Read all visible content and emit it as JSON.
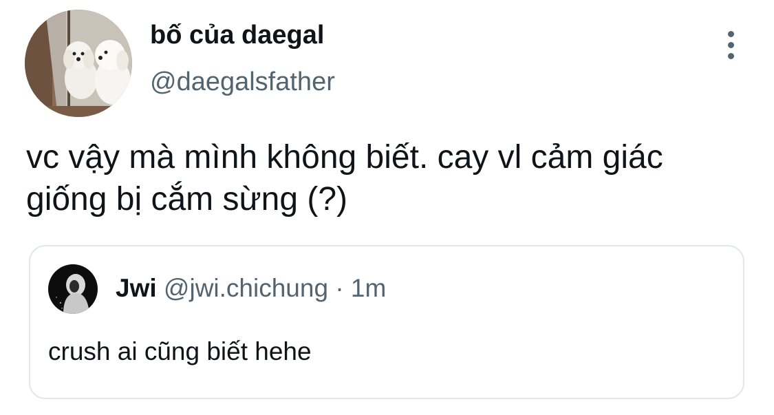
{
  "tweet": {
    "display_name": "bố của daegal",
    "handle": "@daegalsfather",
    "text": "vc vậy mà mình không biết. cay vl cảm giác giống bị cắm sừng (?)",
    "avatar_icon": "avatar-two-white-dogs",
    "more_icon": "more-vertical-icon"
  },
  "quoted_tweet": {
    "display_name": "Jwi",
    "handle": "@jwi.chichung",
    "separator": "·",
    "time": "1m",
    "text": "crush ai cũng biết hehe",
    "avatar_icon": "avatar-person-hoodie"
  },
  "colors": {
    "text_primary": "#0f1419",
    "text_secondary": "#536471",
    "border": "#e1e8ed"
  }
}
